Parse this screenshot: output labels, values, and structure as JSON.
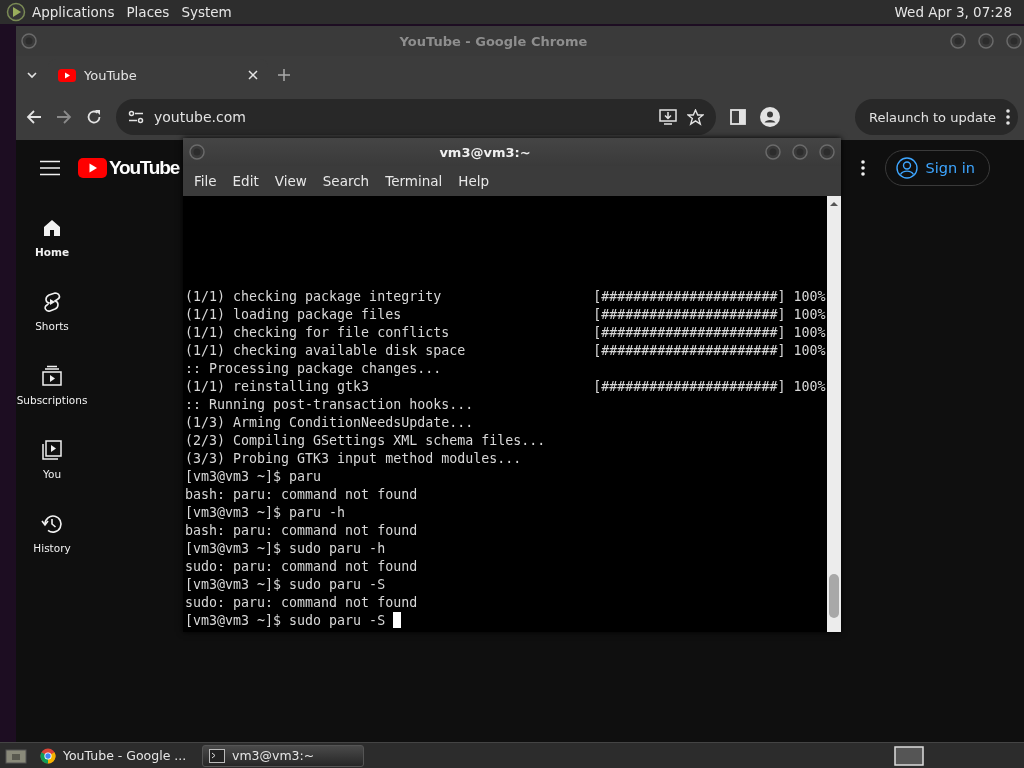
{
  "top_panel": {
    "menus": [
      "Applications",
      "Places",
      "System"
    ],
    "clock": "Wed Apr 3, 07:28"
  },
  "chrome": {
    "title": "YouTube - Google Chrome",
    "tab": {
      "label": "YouTube",
      "selected": true
    },
    "url": "youtube.com",
    "relaunch": "Relaunch to update",
    "youtube": {
      "logo_text": "YouTube",
      "sign_in": "Sign in",
      "sidebar": [
        {
          "label": "Home",
          "kind": "home",
          "selected": true
        },
        {
          "label": "Shorts",
          "kind": "shorts",
          "selected": false
        },
        {
          "label": "Subscriptions",
          "kind": "subscriptions",
          "selected": false
        },
        {
          "label": "You",
          "kind": "you",
          "selected": false
        },
        {
          "label": "History",
          "kind": "history",
          "selected": false
        }
      ]
    }
  },
  "terminal": {
    "title": "vm3@vm3:~",
    "menus": [
      "File",
      "Edit",
      "View",
      "Search",
      "Terminal",
      "Help"
    ],
    "lines": [
      {
        "text": "(1/1) checking package integrity",
        "progress": "[######################] 100%"
      },
      {
        "text": "(1/1) loading package files",
        "progress": "[######################] 100%"
      },
      {
        "text": "(1/1) checking for file conflicts",
        "progress": "[######################] 100%"
      },
      {
        "text": "(1/1) checking available disk space",
        "progress": "[######################] 100%"
      },
      {
        "text": ":: Processing package changes..."
      },
      {
        "text": "(1/1) reinstalling gtk3",
        "progress": "[######################] 100%"
      },
      {
        "text": ":: Running post-transaction hooks..."
      },
      {
        "text": "(1/3) Arming ConditionNeedsUpdate..."
      },
      {
        "text": "(2/3) Compiling GSettings XML schema files..."
      },
      {
        "text": "(3/3) Probing GTK3 input method modules..."
      },
      {
        "text": "[vm3@vm3 ~]$ paru"
      },
      {
        "text": "bash: paru: command not found"
      },
      {
        "text": "[vm3@vm3 ~]$ paru -h"
      },
      {
        "text": "bash: paru: command not found"
      },
      {
        "text": "[vm3@vm3 ~]$ sudo paru -h"
      },
      {
        "text": "sudo: paru: command not found"
      },
      {
        "text": "[vm3@vm3 ~]$ sudo paru -S"
      },
      {
        "text": "sudo: paru: command not found"
      },
      {
        "text": "[vm3@vm3 ~]$ sudo paru -S ",
        "cursor": true
      }
    ]
  },
  "taskbar": {
    "tasks": [
      {
        "label": "YouTube - Google ...",
        "kind": "chrome",
        "selected": false
      },
      {
        "label": "vm3@vm3:~",
        "kind": "terminal",
        "selected": true
      }
    ]
  }
}
